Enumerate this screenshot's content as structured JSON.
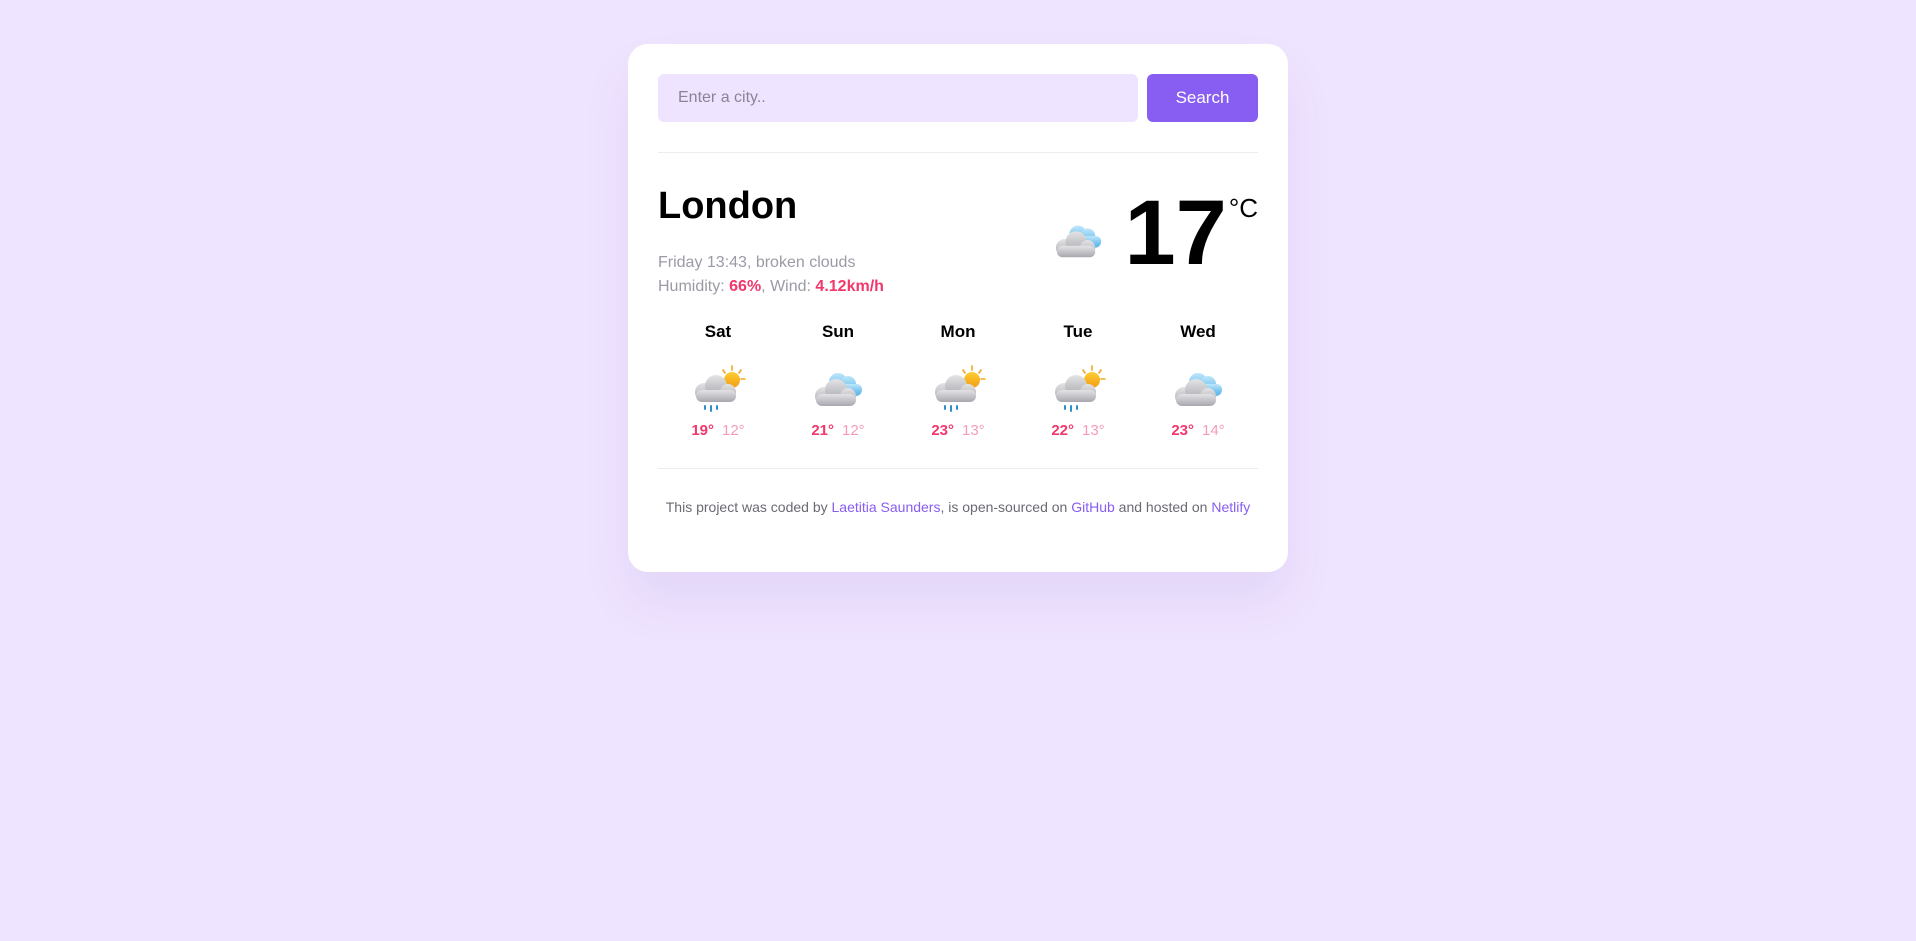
{
  "search": {
    "placeholder": "Enter a city..",
    "button_label": "Search"
  },
  "current": {
    "city": "London",
    "datetime": "Friday 13:43",
    "description": "broken clouds",
    "humidity_label": "Humidity:",
    "humidity_value": "66%",
    "wind_label": "Wind:",
    "wind_value": "4.12km/h",
    "temperature": "17",
    "unit": "°C",
    "icon": "broken-clouds-icon"
  },
  "forecast": [
    {
      "day": "Sat",
      "max": "19°",
      "min": "12°",
      "icon": "sun-cloud-rain-icon"
    },
    {
      "day": "Sun",
      "max": "21°",
      "min": "12°",
      "icon": "broken-clouds-icon"
    },
    {
      "day": "Mon",
      "max": "23°",
      "min": "13°",
      "icon": "sun-cloud-rain-icon"
    },
    {
      "day": "Tue",
      "max": "22°",
      "min": "13°",
      "icon": "sun-cloud-rain-icon"
    },
    {
      "day": "Wed",
      "max": "23°",
      "min": "14°",
      "icon": "broken-clouds-icon"
    }
  ],
  "footer": {
    "text_1": "This project was coded by ",
    "author_link": "Laetitia Saunders",
    "text_2": ", is open-sourced on ",
    "github_link": "GitHub",
    "text_3": " and hosted on ",
    "netlify_link": "Netlify"
  },
  "colors": {
    "background": "#efe4ff",
    "accent": "#885df1",
    "highlight": "#f2376b"
  }
}
